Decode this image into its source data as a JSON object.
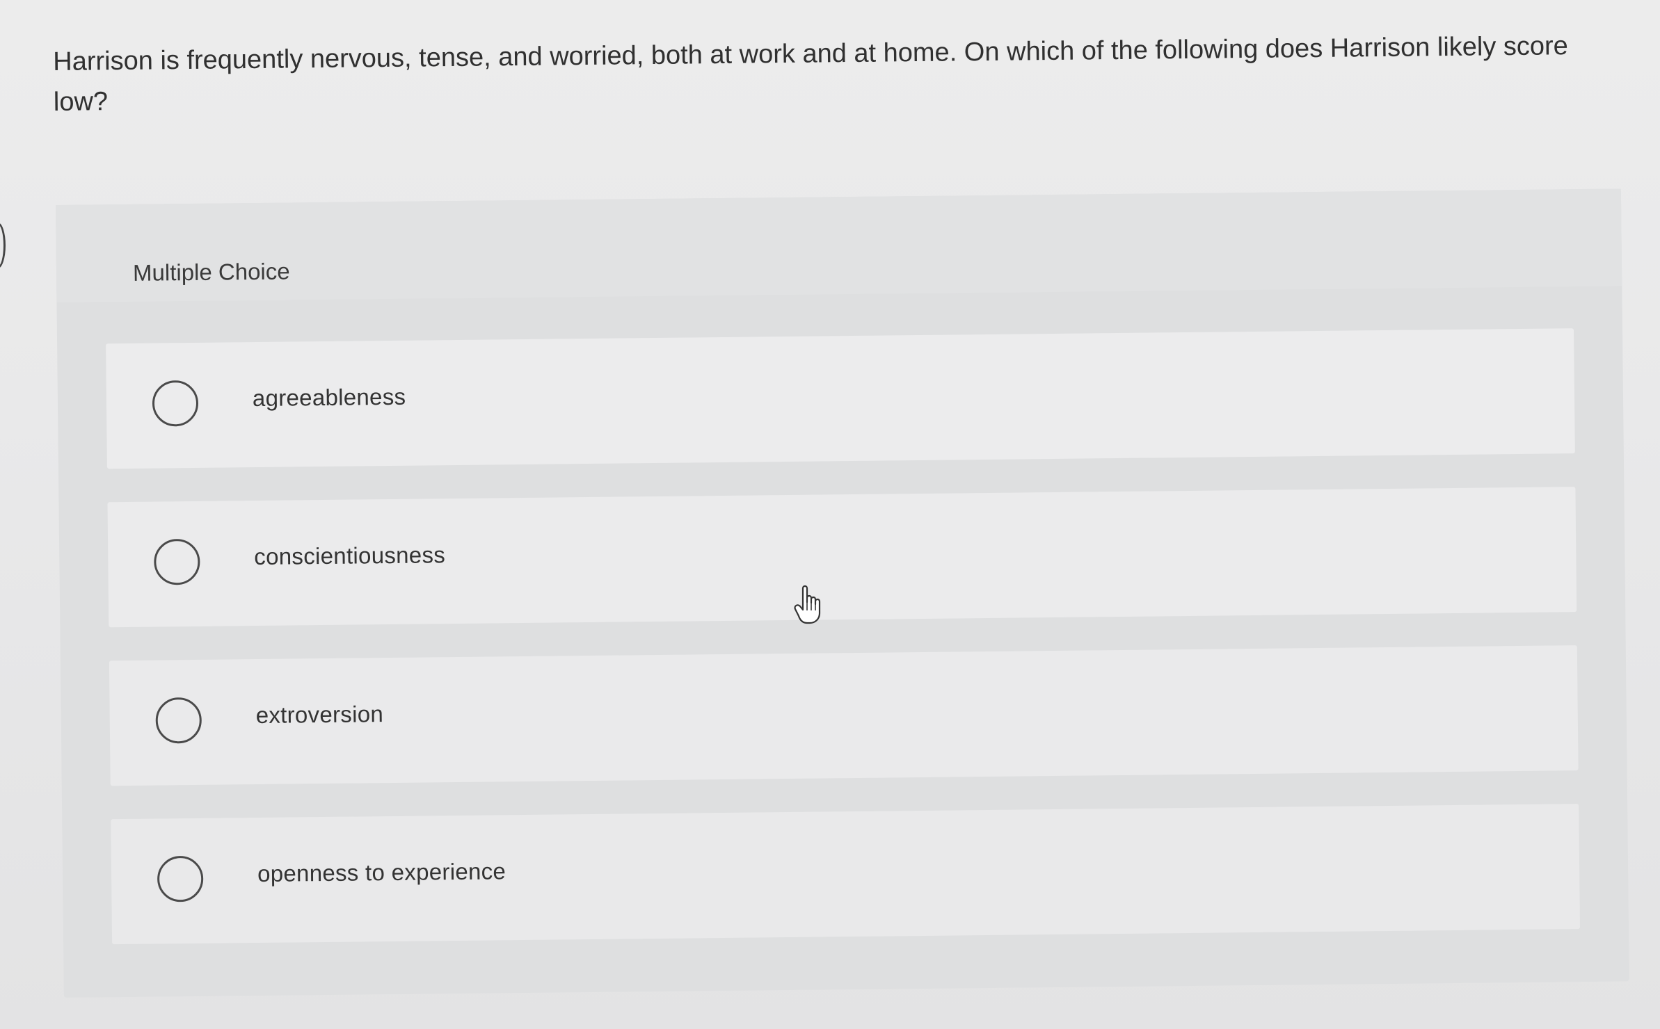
{
  "question": {
    "text": "Harrison is frequently nervous, tense, and worried, both at work and at home. On which of the following does Harrison likely score low?"
  },
  "panel": {
    "type_label": "Multiple Choice"
  },
  "options": [
    {
      "label": "agreeableness",
      "selected": false
    },
    {
      "label": "conscientiousness",
      "selected": false
    },
    {
      "label": "extroversion",
      "selected": false
    },
    {
      "label": "openness to experience",
      "selected": false
    }
  ],
  "cursor": {
    "icon": "hand-pointer-icon"
  },
  "colors": {
    "background": "#e9e9ea",
    "panel": "#dedfe0",
    "option": "#ececed",
    "text": "#303030",
    "radio_border": "#4a4a4a"
  }
}
